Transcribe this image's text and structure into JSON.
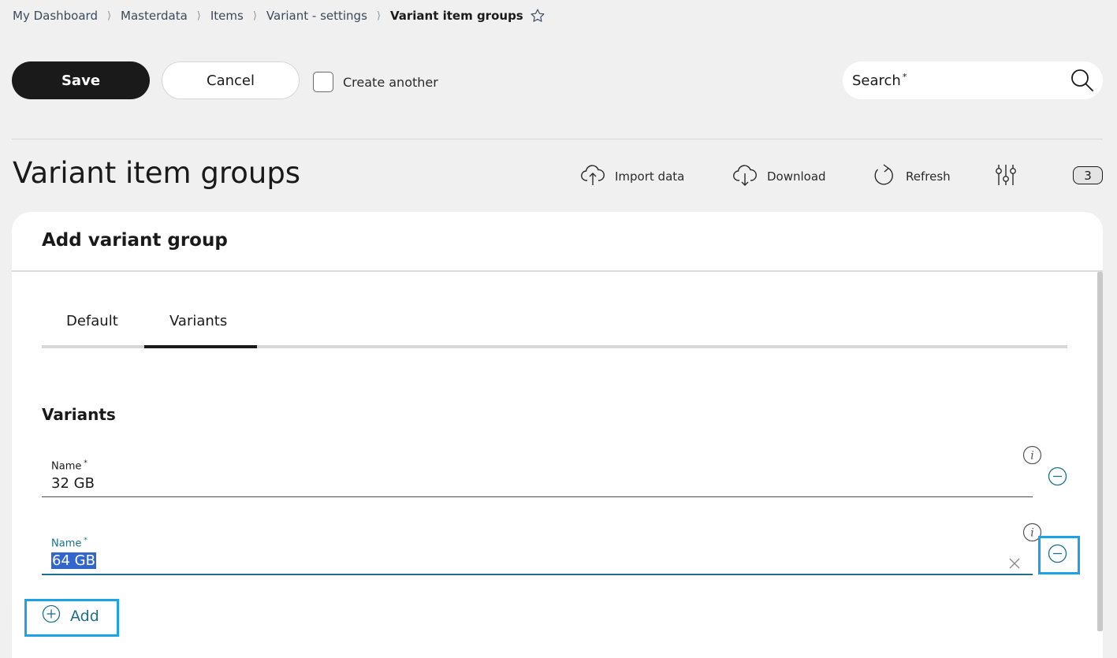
{
  "breadcrumb": {
    "items": [
      "My Dashboard",
      "Masterdata",
      "Items",
      "Variant - settings"
    ],
    "current": "Variant item groups",
    "separator": "⟩"
  },
  "toolbar": {
    "save_label": "Save",
    "cancel_label": "Cancel",
    "create_another_label": "Create another",
    "create_another_checked": false
  },
  "search": {
    "label": "Search",
    "required_mark": "*"
  },
  "page": {
    "title": "Variant item groups",
    "actions": {
      "import_label": "Import data",
      "download_label": "Download",
      "refresh_label": "Refresh"
    },
    "badge_count": "3"
  },
  "panel": {
    "title": "Add variant group",
    "tabs": [
      {
        "label": "Default",
        "active": false
      },
      {
        "label": "Variants",
        "active": true
      }
    ],
    "section_title": "Variants",
    "fields": [
      {
        "label": "Name",
        "required_mark": "*",
        "value": "32 GB",
        "active": false
      },
      {
        "label": "Name",
        "required_mark": "*",
        "value": "64 GB",
        "active": true,
        "selected": true
      }
    ],
    "add_label": "Add"
  },
  "colors": {
    "primary_dark": "#1a1a1a",
    "accent_teal": "#1c6f8c",
    "highlight": "#1aa3e8",
    "selection": "#3366cc",
    "background": "#f0f0f0"
  }
}
